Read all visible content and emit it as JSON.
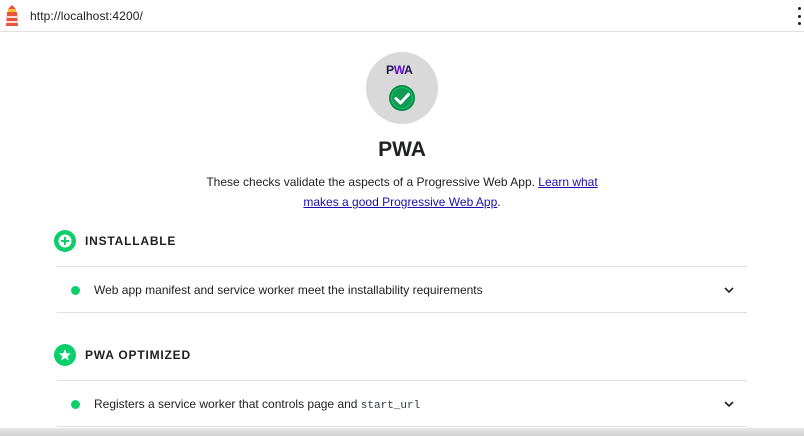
{
  "browser": {
    "url": "http://localhost:4200/"
  },
  "category": {
    "gauge_logo_text_p": "P",
    "gauge_logo_text_w": "W",
    "gauge_logo_text_a": "A",
    "title": "PWA",
    "description": "These checks validate the aspects of a Progressive Web App. ",
    "learn_more_link": "Learn what makes a good Progressive Web App",
    "description_end": ".",
    "status": "pass"
  },
  "groups": [
    {
      "label": "INSTALLABLE",
      "icon": "plus-circle-icon",
      "audits": [
        {
          "text": "Web app manifest and service worker meet the installability requirements",
          "status": "pass"
        }
      ]
    },
    {
      "label": "PWA OPTIMIZED",
      "icon": "star-circle-icon",
      "audits": [
        {
          "text": "Registers a service worker that controls page and ",
          "code": "start_url",
          "status": "pass"
        }
      ]
    }
  ],
  "colors": {
    "pass": "#0cce6b",
    "link": "#1a0dab",
    "gauge_bg": "#d9d9d9"
  }
}
